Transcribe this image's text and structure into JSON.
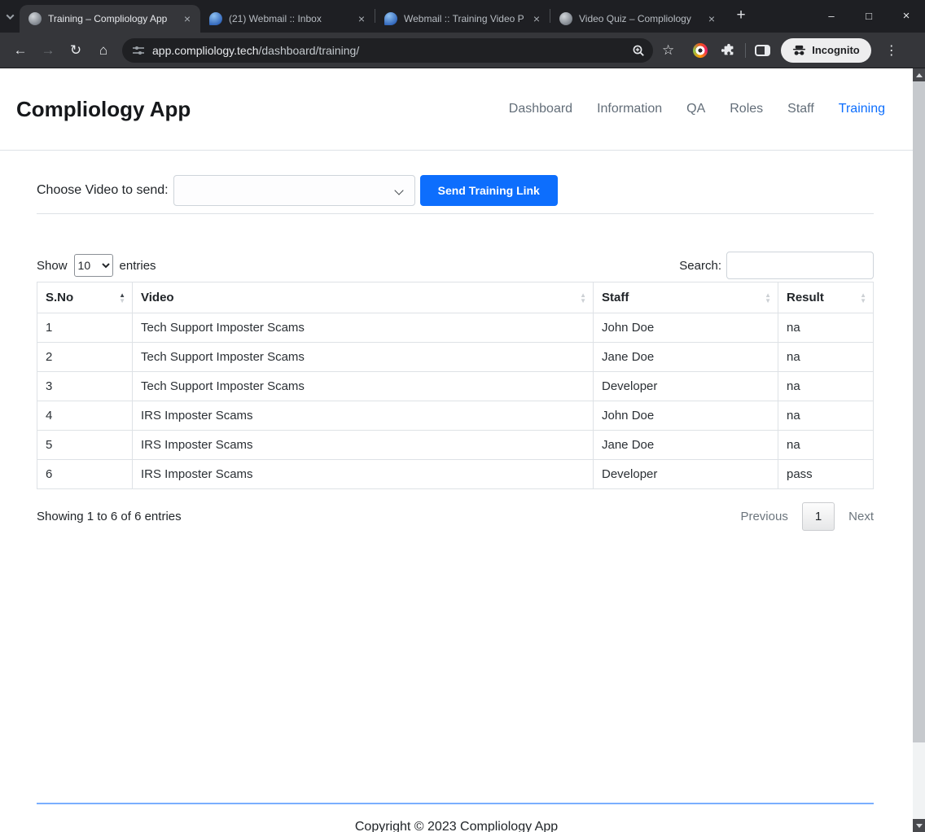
{
  "browser": {
    "tabs": [
      {
        "title": "Training – Compliology App",
        "favicon": "compliology",
        "active": true
      },
      {
        "title": "(21) Webmail :: Inbox",
        "favicon": "roundcube",
        "active": false
      },
      {
        "title": "Webmail :: Training Video P",
        "favicon": "roundcube",
        "active": false
      },
      {
        "title": "Video Quiz – Compliology",
        "favicon": "compliology",
        "active": false
      }
    ],
    "url": {
      "domain": "app.compliology.tech",
      "path": "/dashboard/training/"
    },
    "incognito_label": "Incognito"
  },
  "icons": {
    "close": "×",
    "minimize": "–",
    "maximize": "□",
    "new_tab": "+",
    "back": "←",
    "forward": "→",
    "reload": "↻",
    "home": "⌂",
    "star": "☆",
    "dots": "⋮",
    "sort_up": "▲",
    "sort_down": "▼"
  },
  "page": {
    "brand": "Compliology App",
    "nav": [
      {
        "label": "Dashboard",
        "active": false
      },
      {
        "label": "Information",
        "active": false
      },
      {
        "label": "QA",
        "active": false
      },
      {
        "label": "Roles",
        "active": false
      },
      {
        "label": "Staff",
        "active": false
      },
      {
        "label": "Training",
        "active": true
      }
    ],
    "form": {
      "label": "Choose Video to send:",
      "select_value": "",
      "button_label": "Send Training Link"
    },
    "controls": {
      "show_label": "Show",
      "page_size": "10",
      "entries_label": "entries",
      "search_label": "Search:",
      "search_value": ""
    },
    "table": {
      "headers": [
        "S.No",
        "Video",
        "Staff",
        "Result"
      ],
      "rows": [
        [
          "1",
          "Tech Support Imposter Scams",
          "John Doe",
          "na"
        ],
        [
          "2",
          "Tech Support Imposter Scams",
          "Jane Doe",
          "na"
        ],
        [
          "3",
          "Tech Support Imposter Scams",
          "Developer",
          "na"
        ],
        [
          "4",
          "IRS Imposter Scams",
          "John Doe",
          "na"
        ],
        [
          "5",
          "IRS Imposter Scams",
          "Jane Doe",
          "na"
        ],
        [
          "6",
          "IRS Imposter Scams",
          "Developer",
          "pass"
        ]
      ]
    },
    "info_text": "Showing 1 to 6 of 6 entries",
    "pagination": {
      "previous": "Previous",
      "current": "1",
      "next": "Next"
    },
    "footer_text": "Copyright © 2023 Compliology App"
  },
  "colors": {
    "accent": "#0d6efd",
    "chrome_dark": "#1e1f23",
    "chrome_toolbar": "#35363a",
    "table_border": "#dee2e6"
  }
}
